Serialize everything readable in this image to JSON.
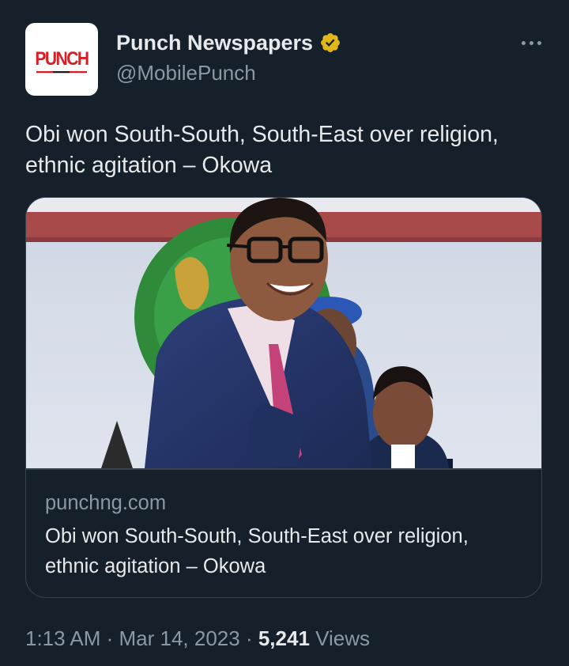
{
  "author": {
    "avatar_logo": "PUNCH",
    "name": "Punch Newspapers",
    "handle": "@MobilePunch",
    "verified_color": "#e2b719"
  },
  "tweet": {
    "text": "Obi won South-South, South-East over religion, ethnic agitation – Okowa"
  },
  "card": {
    "domain": "punchng.com",
    "title": "Obi won South-South, South-East over religion, ethnic agitation – Okowa"
  },
  "meta": {
    "time": "1:13 AM",
    "separator1": " · ",
    "date": "Mar 14, 2023",
    "separator2": " · ",
    "views_count": "5,241",
    "views_label": " Views"
  },
  "colors": {
    "background": "#15202b",
    "primary_text": "#e7e9ea",
    "secondary_text": "#8b98a5",
    "border": "#38444d"
  },
  "icons": [
    "verified-badge-icon",
    "more-options-icon"
  ]
}
